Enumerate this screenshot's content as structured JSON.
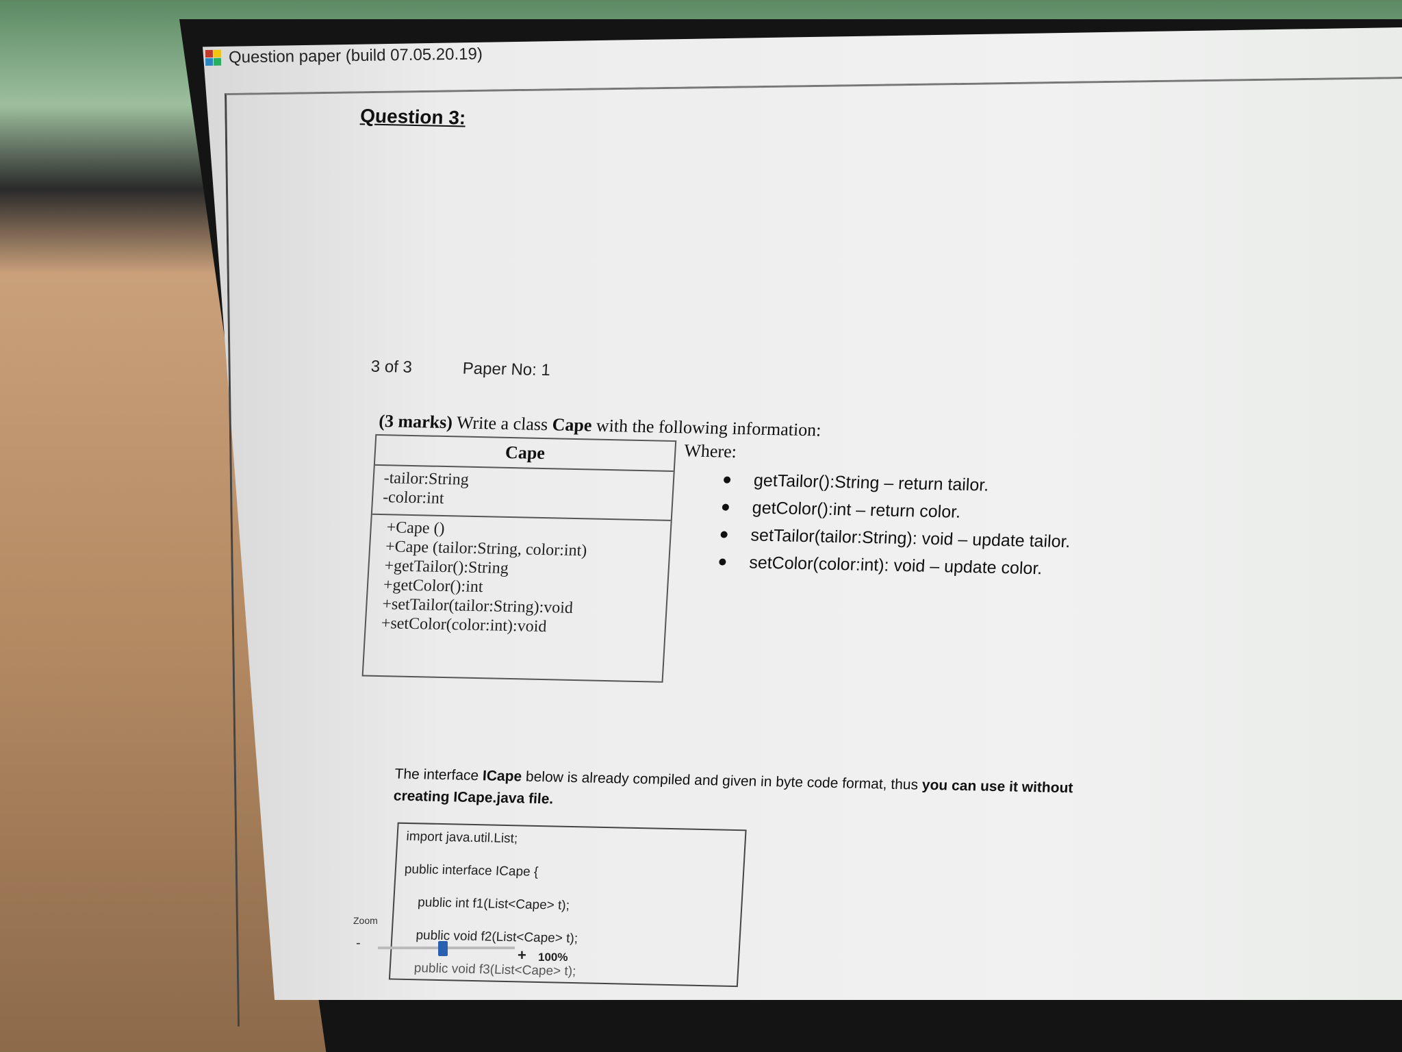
{
  "window": {
    "title": "Question paper (build 07.05.20.19)",
    "icon": "app-icon"
  },
  "document": {
    "question_title": "Question 3:",
    "page_indicator": "3 of 3",
    "paper_no": "Paper No: 1",
    "question": {
      "marks": "(3 marks)",
      "text_before_class": "Write a class",
      "class_name": "Cape",
      "text_after_class": "with the following information:"
    },
    "uml": {
      "class_name": "Cape",
      "attributes": [
        "-tailor:String",
        "-color:int"
      ],
      "methods": [
        "+Cape ()",
        "+Cape (tailor:String, color:int)",
        "+getTailor():String",
        "+getColor():int",
        "+setTailor(tailor:String):void",
        "+setColor(color:int):void"
      ]
    },
    "where_label": "Where:",
    "where_items": [
      "getTailor():String – return tailor.",
      "getColor():int – return color.",
      "setTailor(tailor:String): void – update tailor.",
      "setColor(color:int): void – update color."
    ],
    "interface_note": {
      "part1": "The interface ",
      "iface": "ICape",
      "part2": " below is already compiled and given in byte code format, thus ",
      "part3": "you can use it without creating ICape.java file."
    },
    "code": [
      "import java.util.List;",
      "public interface ICape {",
      "public int f1(List<Cape> t);",
      "public void f2(List<Cape> t);",
      "public void f3(List<Cape> t);"
    ]
  },
  "zoom": {
    "label": "Zoom",
    "minus": "-",
    "plus": "+",
    "value": "100%",
    "level_percent": 100
  }
}
